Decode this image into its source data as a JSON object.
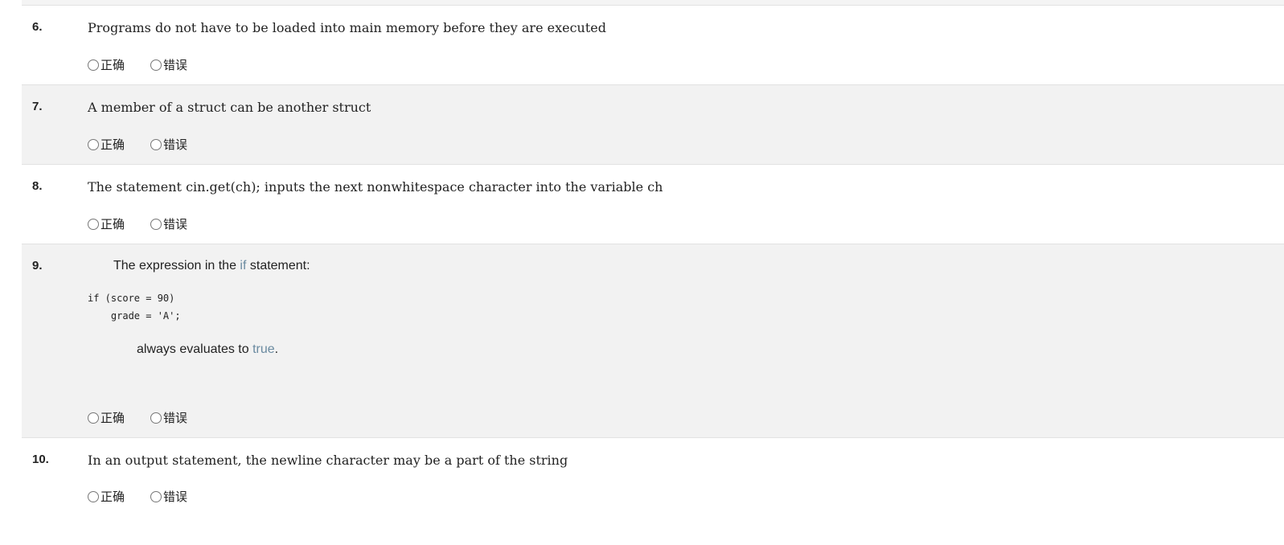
{
  "options": [
    "正确",
    "错误"
  ],
  "questions": [
    {
      "num": "6.",
      "text": "Programs do not have to be loaded into main memory before they are executed"
    },
    {
      "num": "7.",
      "text": "A member of a struct can be another struct"
    },
    {
      "num": "8.",
      "text": "The statement cin.get(ch); inputs the next nonwhitespace character into the variable ch"
    },
    {
      "num": "9.",
      "intro_a": "The expression in the ",
      "intro_kw": "if",
      "intro_b": " statement:",
      "code": "if (score = 90)\n    grade = 'A';",
      "outro_a": "always evaluates to ",
      "outro_kw": "true",
      "outro_b": "."
    },
    {
      "num": "10.",
      "text": "In an output statement, the newline character may be a part of the string"
    }
  ]
}
